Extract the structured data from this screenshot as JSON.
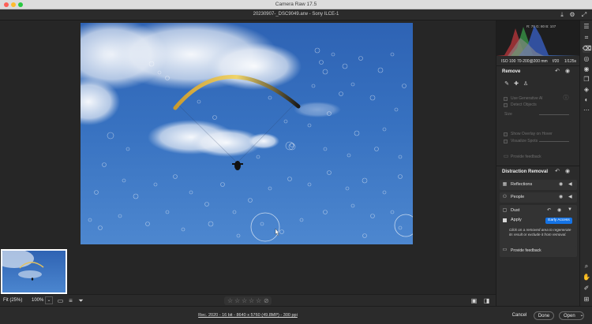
{
  "app": {
    "title": "Camera Raw 17.5"
  },
  "header": {
    "file_title": "20230907-_DSC9049.arw  -  Sony ILCE-1",
    "icons": [
      "export-icon",
      "settings-gear-icon",
      "fullscreen-icon"
    ]
  },
  "histogram": {
    "readout": "R: 70   G: 80   B: 107"
  },
  "exif": {
    "iso": "ISO 100",
    "lens": "70-200@200 mm",
    "aperture": "f/20",
    "shutter": "1/125s"
  },
  "remove": {
    "title": "Remove",
    "use_generative_ai": "Use Generative AI",
    "detect_objects": "Detect Objects",
    "size_label": "Size",
    "show_overlay": "Show Overlay on Hover",
    "visualize_spots": "Visualize Spots",
    "provide_feedback": "Provide feedback"
  },
  "distraction": {
    "title": "Distraction Removal",
    "reflections": "Reflections",
    "people": "People",
    "dust": "Dust",
    "apply": "Apply",
    "badge": "Early Access",
    "help": "Click on a removed area to regenerate its result or exclude it from removal.",
    "provide_feedback": "Provide feedback"
  },
  "canvas_toolbar": {
    "fit": "Fit (25%)",
    "zoom": "100%",
    "stars_count": 5
  },
  "status": {
    "file_info": "Rec. 2020 - 16 bit - 8640 x 5760 (49.8MP) - 300 ppi",
    "cancel": "Cancel",
    "done": "Done",
    "open": "Open"
  }
}
